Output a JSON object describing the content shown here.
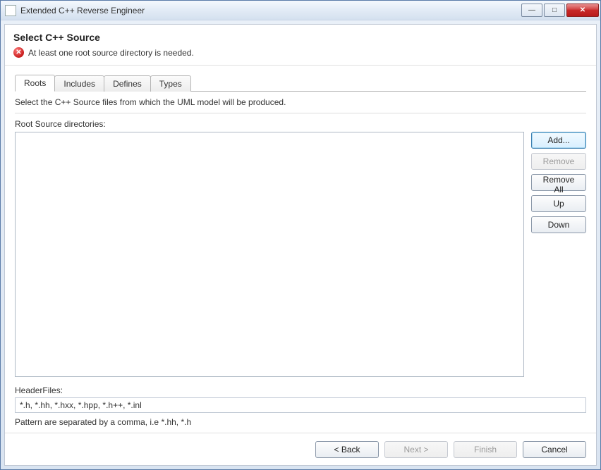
{
  "window": {
    "title": "Extended C++ Reverse Engineer"
  },
  "header": {
    "title": "Select C++ Source",
    "error": "At least one root source directory is needed."
  },
  "tabs": {
    "items": [
      {
        "label": "Roots",
        "active": true
      },
      {
        "label": "Includes",
        "active": false
      },
      {
        "label": "Defines",
        "active": false
      },
      {
        "label": "Types",
        "active": false
      }
    ]
  },
  "roots_panel": {
    "description": "Select the C++ Source files from which the UML model will be produced.",
    "list_label": "Root Source directories:",
    "buttons": {
      "add": "Add...",
      "remove": "Remove",
      "remove_all": "Remove All",
      "up": "Up",
      "down": "Down"
    },
    "header_files_label": "HeaderFiles:",
    "header_files_value": "*.h, *.hh, *.hxx, *.hpp, *.h++, *.inl",
    "pattern_hint": "Pattern are separated by a comma, i.e *.hh, *.h"
  },
  "footer": {
    "back": "< Back",
    "next": "Next >",
    "finish": "Finish",
    "cancel": "Cancel"
  }
}
